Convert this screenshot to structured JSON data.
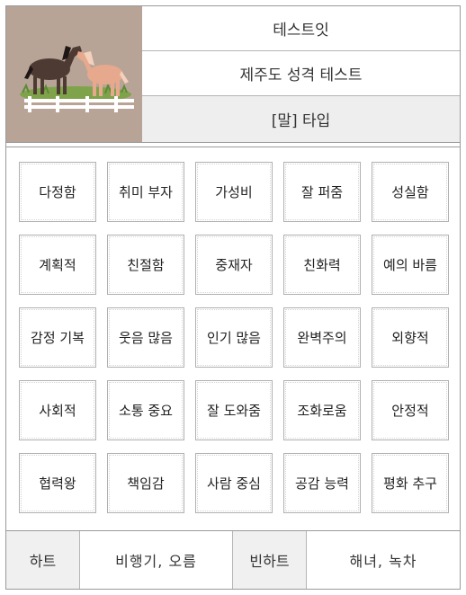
{
  "header": {
    "site": "테스트잇",
    "test_name": "제주도 성격 테스트",
    "result_type": "[말] 타입"
  },
  "traits": [
    "다정함",
    "취미 부자",
    "가성비",
    "잘 퍼줌",
    "성실함",
    "계획적",
    "친절함",
    "중재자",
    "친화력",
    "예의 바름",
    "감정 기복",
    "웃음 많음",
    "인기 많음",
    "완벽주의",
    "외향적",
    "사회적",
    "소통 중요",
    "잘 도와줌",
    "조화로움",
    "안정적",
    "협력왕",
    "책임감",
    "사람 중심",
    "공감 능력",
    "평화 추구"
  ],
  "footer": {
    "good_label": "하트",
    "good_value": "비행기, 오름",
    "bad_label": "빈하트",
    "bad_value": "해녀, 녹차"
  },
  "colors": {
    "thumb_bg": "#b8a496",
    "result_row_bg": "#eeeeee",
    "border": "#9a9a9a"
  }
}
